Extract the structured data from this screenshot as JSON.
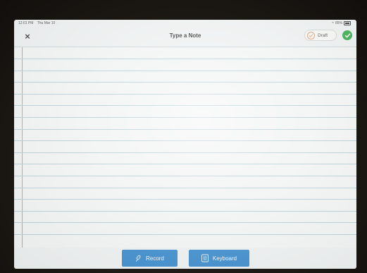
{
  "status_bar": {
    "time": "12:01 PM",
    "date": "Thu Mar 10",
    "battery": "85%"
  },
  "navbar": {
    "title": "Type a Note",
    "draft_label": "Draft",
    "close_icon": "close-icon",
    "done_icon": "checkmark-circle-icon"
  },
  "note": {
    "text": "",
    "ruled_line_count": 16
  },
  "toolbar": {
    "record_label": "Record",
    "keyboard_label": "Keyboard",
    "record_icon": "microphone-icon",
    "keyboard_icon": "keyboard-icon"
  },
  "colors": {
    "accent": "#3d8ccc",
    "done": "#3fae52",
    "margin_line": "#d79a9a",
    "ruled_line": "#b9cfd6"
  }
}
